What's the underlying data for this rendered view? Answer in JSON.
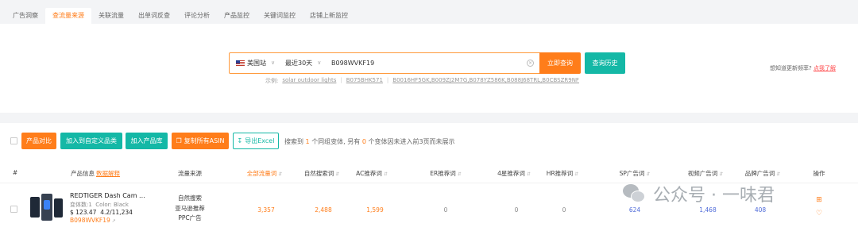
{
  "tabs": [
    {
      "label": "广告洞察",
      "active": false
    },
    {
      "label": "查流量来源",
      "active": true
    },
    {
      "label": "关联流量",
      "active": false
    },
    {
      "label": "出单词反查",
      "active": false
    },
    {
      "label": "评论分析",
      "active": false
    },
    {
      "label": "产品监控",
      "active": false
    },
    {
      "label": "关键词监控",
      "active": false
    },
    {
      "label": "店铺上新监控",
      "active": false
    }
  ],
  "search": {
    "site": "美国站",
    "range": "最近30天",
    "asin_value": "B098WVKF19",
    "query_button": "立即查询",
    "history_button": "查询历史",
    "examples_label": "示例:",
    "examples": [
      "solar outdoor lights",
      "B075BHK571",
      "B0016HF5GK,B009ZJ2M7G,B078YZ586K,B088J68TRL,B0CBSZR9NF"
    ]
  },
  "update_note": {
    "text": "想知道更新频率?",
    "link": "点我了解"
  },
  "toolbar": {
    "compare": "产品对比",
    "add_custom": "加入到自定义品类",
    "add_library": "加入产品库",
    "copy_asin": "复制所有ASIN",
    "export": "导出Excel",
    "summary_prefix": "搜索到",
    "variants_count": "1",
    "summary_mid": "个同组变体, 另有",
    "excluded_count": "0",
    "summary_suffix": "个变体因未进入前3页而未展示"
  },
  "table": {
    "headers": {
      "index": "#",
      "product": "产品信息",
      "product_link": "数据解释",
      "source": "流量来源",
      "total": "全部流量词",
      "organic": "自然搜索词",
      "ac": "AC推荐词",
      "er": "ER推荐词",
      "four_star": "4星推荐词",
      "hr": "HR推荐词",
      "sp": "SP广告词",
      "video": "视频广告词",
      "brand": "品牌广告词",
      "ops": "操作"
    },
    "rows": [
      {
        "name": "REDTIGER Dash Cam ...",
        "variants": "变体数:1",
        "color": "Color: Black",
        "price": "$ 123.47",
        "rating": "4.2/11,234",
        "asin": "B098WVKF19",
        "sources": [
          "自然搜索",
          "亚马逊推荐",
          "PPC广告"
        ],
        "total": "3,357",
        "organic": "2,488",
        "ac": "1,599",
        "er": "0",
        "four_star": "0",
        "hr": "0",
        "sp": "624",
        "video": "1,468",
        "brand": "408"
      }
    ]
  },
  "watermark": "公众号 · 一味君",
  "colors": {
    "accent": "#ff7d1a",
    "teal": "#14b8a6",
    "blue": "#4f6bd9"
  }
}
